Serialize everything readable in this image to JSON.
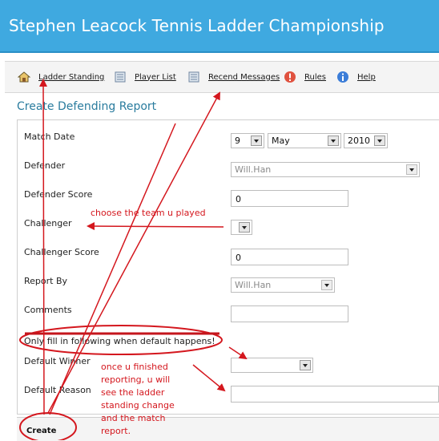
{
  "header": {
    "title": "Stephen Leacock Tennis Ladder Championship"
  },
  "nav": {
    "items": [
      {
        "label": "Ladder Standing",
        "icon": "home-icon"
      },
      {
        "label": "Player List",
        "icon": "document-icon"
      },
      {
        "label": "Recend Messages",
        "icon": "document-icon"
      },
      {
        "label": "Rules",
        "icon": "alert-icon"
      },
      {
        "label": "Help",
        "icon": "info-icon"
      }
    ]
  },
  "form": {
    "title": "Create Defending Report",
    "match_date": {
      "label": "Match Date",
      "day": "9",
      "month": "May",
      "year": "2010"
    },
    "defender": {
      "label": "Defender",
      "value": "Will.Han"
    },
    "defender_score": {
      "label": "Defender Score",
      "value": "0"
    },
    "challenger": {
      "label": "Challenger",
      "value": ""
    },
    "challenger_score": {
      "label": "Challenger Score",
      "value": "0"
    },
    "report_by": {
      "label": "Report By",
      "value": "Will.Han"
    },
    "comments": {
      "label": "Comments",
      "value": ""
    },
    "default_note": "Only fill in following when default happens!",
    "default_winner": {
      "label": "Default Winner",
      "value": ""
    },
    "default_reason": {
      "label": "Default Reason",
      "value": ""
    },
    "create_label": "Create"
  },
  "annotations": {
    "challenger_note": "choose the team u played",
    "finish_note_lines": [
      "once u finished",
      "reporting, u will",
      "see the ladder",
      "standing change",
      "and the match",
      "report."
    ]
  },
  "colors": {
    "header": "#3fa9e0",
    "annotation": "#d4171e",
    "section_title": "#2a7c9e"
  }
}
